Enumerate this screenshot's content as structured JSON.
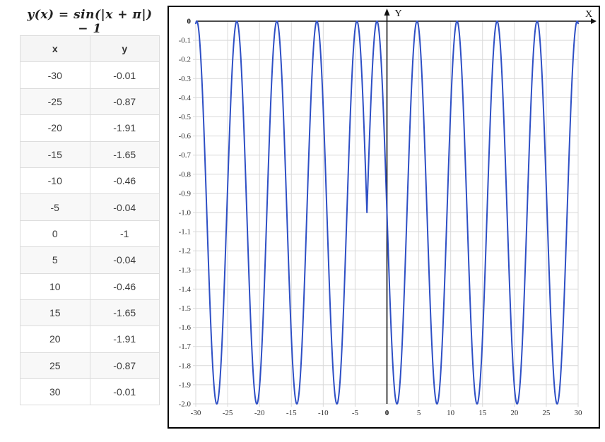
{
  "formula": {
    "text": "y(x) = sin(|x + π|) − 1"
  },
  "table": {
    "headers": [
      "x",
      "y"
    ],
    "rows": [
      [
        "-30",
        "-0.01"
      ],
      [
        "-25",
        "-0.87"
      ],
      [
        "-20",
        "-1.91"
      ],
      [
        "-15",
        "-1.65"
      ],
      [
        "-10",
        "-0.46"
      ],
      [
        "-5",
        "-0.04"
      ],
      [
        "0",
        "-1"
      ],
      [
        "5",
        "-0.04"
      ],
      [
        "10",
        "-0.46"
      ],
      [
        "15",
        "-1.65"
      ],
      [
        "20",
        "-1.91"
      ],
      [
        "25",
        "-0.87"
      ],
      [
        "30",
        "-0.01"
      ]
    ]
  },
  "chart_data": {
    "type": "line",
    "title": "y(x) = sin(|x + π|) − 1",
    "expression_js": "Math.sin(Math.abs(x + Math.PI)) - 1",
    "x_range": [
      -30,
      30
    ],
    "y_range": [
      -2,
      0
    ],
    "x_tick_labels": [
      "-30",
      "-25",
      "-20",
      "-15",
      "-10",
      "-5",
      "0",
      "5",
      "10",
      "15",
      "20",
      "25",
      "30"
    ],
    "y_tick_labels": [
      "0",
      "-0.1",
      "-0.2",
      "-0.3",
      "-0.4",
      "-0.5",
      "-0.6",
      "-0.7",
      "-0.8",
      "-0.9",
      "-1.0",
      "-1.1",
      "-1.2",
      "-1.3",
      "-1.4",
      "-1.5",
      "-1.6",
      "-1.7",
      "-1.8",
      "-1.9",
      "-2.0"
    ],
    "x_axis_label": "X",
    "y_axis_label": "Y",
    "grid": true,
    "legend": "none",
    "colors": {
      "curve": "#2e4fc5",
      "grid": "#d9d9d9",
      "axis": "#111111",
      "tick_text": "#333333"
    },
    "cusp_point": [
      -3.14159,
      -1
    ],
    "points_from_table": [
      [
        -30,
        -0.01
      ],
      [
        -25,
        -0.87
      ],
      [
        -20,
        -1.91
      ],
      [
        -15,
        -1.65
      ],
      [
        -10,
        -0.46
      ],
      [
        -5,
        -0.04
      ],
      [
        0,
        -1
      ],
      [
        5,
        -0.04
      ],
      [
        10,
        -0.46
      ],
      [
        15,
        -1.65
      ],
      [
        20,
        -1.91
      ],
      [
        25,
        -0.87
      ],
      [
        30,
        -0.01
      ]
    ]
  }
}
